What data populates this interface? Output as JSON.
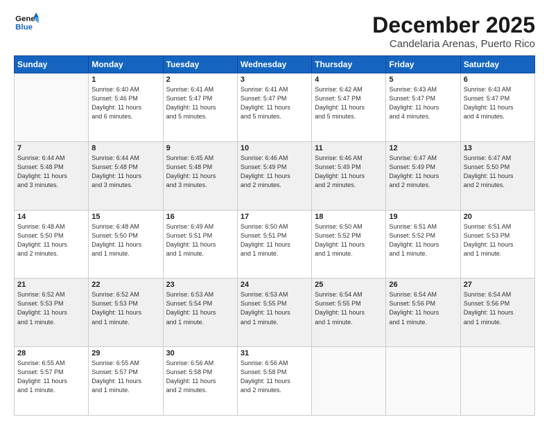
{
  "header": {
    "logo_line1": "General",
    "logo_line2": "Blue",
    "title": "December 2025",
    "subtitle": "Candelaria Arenas, Puerto Rico"
  },
  "weekdays": [
    "Sunday",
    "Monday",
    "Tuesday",
    "Wednesday",
    "Thursday",
    "Friday",
    "Saturday"
  ],
  "weeks": [
    [
      {
        "day": "",
        "info": ""
      },
      {
        "day": "1",
        "info": "Sunrise: 6:40 AM\nSunset: 5:46 PM\nDaylight: 11 hours\nand 6 minutes."
      },
      {
        "day": "2",
        "info": "Sunrise: 6:41 AM\nSunset: 5:47 PM\nDaylight: 11 hours\nand 5 minutes."
      },
      {
        "day": "3",
        "info": "Sunrise: 6:41 AM\nSunset: 5:47 PM\nDaylight: 11 hours\nand 5 minutes."
      },
      {
        "day": "4",
        "info": "Sunrise: 6:42 AM\nSunset: 5:47 PM\nDaylight: 11 hours\nand 5 minutes."
      },
      {
        "day": "5",
        "info": "Sunrise: 6:43 AM\nSunset: 5:47 PM\nDaylight: 11 hours\nand 4 minutes."
      },
      {
        "day": "6",
        "info": "Sunrise: 6:43 AM\nSunset: 5:47 PM\nDaylight: 11 hours\nand 4 minutes."
      }
    ],
    [
      {
        "day": "7",
        "info": "Sunrise: 6:44 AM\nSunset: 5:48 PM\nDaylight: 11 hours\nand 3 minutes."
      },
      {
        "day": "8",
        "info": "Sunrise: 6:44 AM\nSunset: 5:48 PM\nDaylight: 11 hours\nand 3 minutes."
      },
      {
        "day": "9",
        "info": "Sunrise: 6:45 AM\nSunset: 5:48 PM\nDaylight: 11 hours\nand 3 minutes."
      },
      {
        "day": "10",
        "info": "Sunrise: 6:46 AM\nSunset: 5:49 PM\nDaylight: 11 hours\nand 2 minutes."
      },
      {
        "day": "11",
        "info": "Sunrise: 6:46 AM\nSunset: 5:49 PM\nDaylight: 11 hours\nand 2 minutes."
      },
      {
        "day": "12",
        "info": "Sunrise: 6:47 AM\nSunset: 5:49 PM\nDaylight: 11 hours\nand 2 minutes."
      },
      {
        "day": "13",
        "info": "Sunrise: 6:47 AM\nSunset: 5:50 PM\nDaylight: 11 hours\nand 2 minutes."
      }
    ],
    [
      {
        "day": "14",
        "info": "Sunrise: 6:48 AM\nSunset: 5:50 PM\nDaylight: 11 hours\nand 2 minutes."
      },
      {
        "day": "15",
        "info": "Sunrise: 6:48 AM\nSunset: 5:50 PM\nDaylight: 11 hours\nand 1 minute."
      },
      {
        "day": "16",
        "info": "Sunrise: 6:49 AM\nSunset: 5:51 PM\nDaylight: 11 hours\nand 1 minute."
      },
      {
        "day": "17",
        "info": "Sunrise: 6:50 AM\nSunset: 5:51 PM\nDaylight: 11 hours\nand 1 minute."
      },
      {
        "day": "18",
        "info": "Sunrise: 6:50 AM\nSunset: 5:52 PM\nDaylight: 11 hours\nand 1 minute."
      },
      {
        "day": "19",
        "info": "Sunrise: 6:51 AM\nSunset: 5:52 PM\nDaylight: 11 hours\nand 1 minute."
      },
      {
        "day": "20",
        "info": "Sunrise: 6:51 AM\nSunset: 5:53 PM\nDaylight: 11 hours\nand 1 minute."
      }
    ],
    [
      {
        "day": "21",
        "info": "Sunrise: 6:52 AM\nSunset: 5:53 PM\nDaylight: 11 hours\nand 1 minute."
      },
      {
        "day": "22",
        "info": "Sunrise: 6:52 AM\nSunset: 5:53 PM\nDaylight: 11 hours\nand 1 minute."
      },
      {
        "day": "23",
        "info": "Sunrise: 6:53 AM\nSunset: 5:54 PM\nDaylight: 11 hours\nand 1 minute."
      },
      {
        "day": "24",
        "info": "Sunrise: 6:53 AM\nSunset: 5:55 PM\nDaylight: 11 hours\nand 1 minute."
      },
      {
        "day": "25",
        "info": "Sunrise: 6:54 AM\nSunset: 5:55 PM\nDaylight: 11 hours\nand 1 minute."
      },
      {
        "day": "26",
        "info": "Sunrise: 6:54 AM\nSunset: 5:56 PM\nDaylight: 11 hours\nand 1 minute."
      },
      {
        "day": "27",
        "info": "Sunrise: 6:54 AM\nSunset: 5:56 PM\nDaylight: 11 hours\nand 1 minute."
      }
    ],
    [
      {
        "day": "28",
        "info": "Sunrise: 6:55 AM\nSunset: 5:57 PM\nDaylight: 11 hours\nand 1 minute."
      },
      {
        "day": "29",
        "info": "Sunrise: 6:55 AM\nSunset: 5:57 PM\nDaylight: 11 hours\nand 1 minute."
      },
      {
        "day": "30",
        "info": "Sunrise: 6:56 AM\nSunset: 5:58 PM\nDaylight: 11 hours\nand 2 minutes."
      },
      {
        "day": "31",
        "info": "Sunrise: 6:56 AM\nSunset: 5:58 PM\nDaylight: 11 hours\nand 2 minutes."
      },
      {
        "day": "",
        "info": ""
      },
      {
        "day": "",
        "info": ""
      },
      {
        "day": "",
        "info": ""
      }
    ]
  ]
}
